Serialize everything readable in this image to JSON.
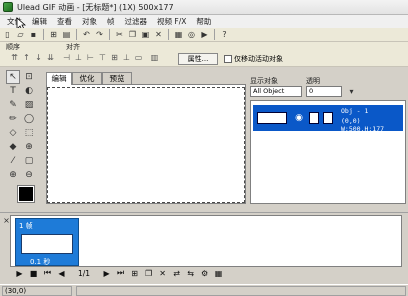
{
  "window": {
    "title": "Ulead GIF 动画 - [无标题*] (1X) 500x177"
  },
  "menu": [
    "文件",
    "编辑",
    "查看",
    "对象",
    "帧",
    "过滤器",
    "视频 F/X",
    "帮助"
  ],
  "toolbar": {
    "icons": [
      "new-icon",
      "open-icon",
      "save-icon",
      "add-image-icon",
      "scan-icon",
      "undo-icon",
      "redo-icon",
      "cut-icon",
      "copy-icon",
      "paste-icon",
      "delete-icon",
      "arrange-icon",
      "optimize-icon",
      "play-icon",
      "help-icon"
    ]
  },
  "order_panel": {
    "order_label": "顺序",
    "align_label": "对齐",
    "properties_button": "属性...",
    "move_only_active_label": "仅移动活动对象"
  },
  "editor_tabs": [
    "编辑",
    "优化",
    "预览"
  ],
  "object_panel": {
    "show_objects_label": "显示对象",
    "show_objects_value": "All Object",
    "opacity_label": "透明",
    "opacity_value": "0",
    "object_name": "Obj - 1",
    "object_info": "(0,0) W:500,H:177"
  },
  "frame_panel": {
    "frame_label": "1 帧",
    "frame_delay": "0.1 秒"
  },
  "player": {
    "frame_counter": "1/1"
  },
  "status": {
    "coords": "(30,0)"
  }
}
